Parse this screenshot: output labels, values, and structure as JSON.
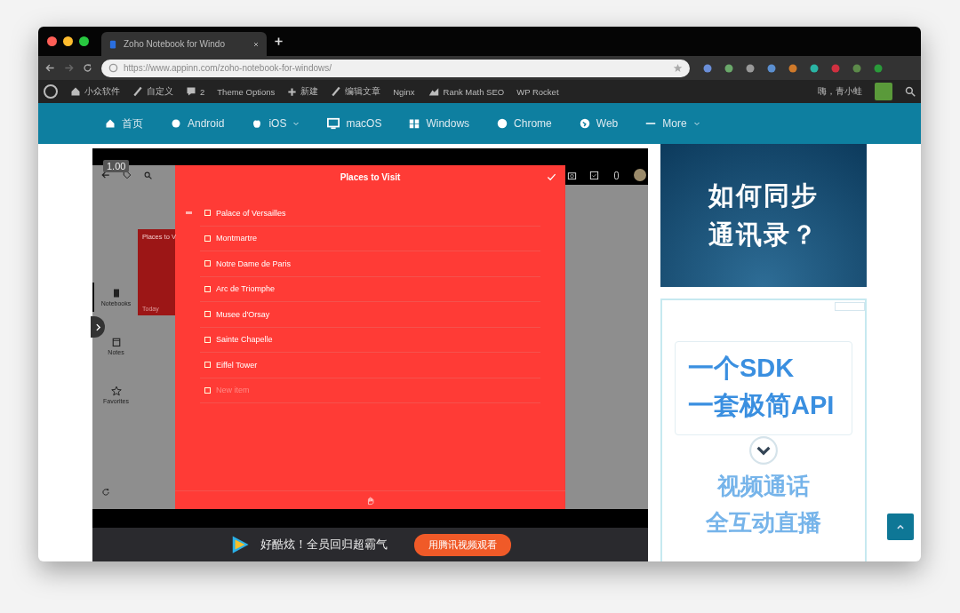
{
  "browser": {
    "tab_title": "Zoho Notebook for Windo",
    "url": "https://www.appinn.com/zoho-notebook-for-windows/"
  },
  "admin_bar": {
    "items": [
      {
        "kind": "home",
        "label": "小众软件"
      },
      {
        "kind": "pen",
        "label": "自定义"
      },
      {
        "kind": "comment",
        "label": "2"
      },
      {
        "kind": "text",
        "label": "Theme Options"
      },
      {
        "kind": "plus",
        "label": "新建"
      },
      {
        "kind": "pen",
        "label": "编辑文章"
      },
      {
        "kind": "text",
        "label": "Nginx"
      },
      {
        "kind": "chart",
        "label": "Rank Math SEO"
      },
      {
        "kind": "text",
        "label": "WP Rocket"
      }
    ],
    "greeting": "嗨，青小蛙"
  },
  "nav": [
    {
      "label": "首页",
      "dropdown": false
    },
    {
      "label": "Android",
      "dropdown": false
    },
    {
      "label": "iOS",
      "dropdown": true
    },
    {
      "label": "macOS",
      "dropdown": false
    },
    {
      "label": "Windows",
      "dropdown": false
    },
    {
      "label": "Chrome",
      "dropdown": false
    },
    {
      "label": "Web",
      "dropdown": false
    },
    {
      "label": "More",
      "dropdown": true
    }
  ],
  "video": {
    "speed": "1.00",
    "app": {
      "sidebar": [
        {
          "label": "Notebooks",
          "selected": true
        },
        {
          "label": "Notes",
          "selected": false
        },
        {
          "label": "Favorites",
          "selected": false
        }
      ],
      "note_card": {
        "title": "Places to V",
        "date": "Today"
      },
      "note": {
        "title": "Places to Visit",
        "items": [
          {
            "text": "Palace of Versailles",
            "checked": false
          },
          {
            "text": "Montmartre",
            "checked": false
          },
          {
            "text": "Notre Dame de Paris",
            "checked": false
          },
          {
            "text": "Arc de Triomphe",
            "checked": false
          },
          {
            "text": "Musee d'Orsay",
            "checked": false
          },
          {
            "text": "Sainte Chapelle",
            "checked": false
          },
          {
            "text": "Eiffel Tower",
            "checked": false
          }
        ],
        "new_item_placeholder": "New item"
      }
    },
    "promo": {
      "text": "好酷炫！全员回归超霸气",
      "button": "用腾讯视频观看"
    }
  },
  "ads": [
    {
      "kind": "dark",
      "lines": [
        "如何同步",
        "通讯录？"
      ]
    },
    {
      "kind": "light",
      "lines": [
        "一个SDK",
        "一套极简API"
      ],
      "sub_lines": [
        "视频通话",
        "全互动直播"
      ]
    }
  ]
}
